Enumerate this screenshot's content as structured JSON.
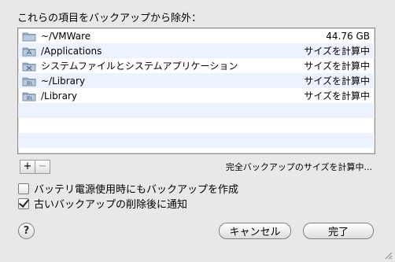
{
  "heading": "これらの項目をバックアップから除外：",
  "exclusions": [
    {
      "icon": "folder-icon",
      "name": "~/VMWare",
      "size": "44.76 GB"
    },
    {
      "icon": "applications-folder-icon",
      "name": "/Applications",
      "size": "サイズを計算中"
    },
    {
      "icon": "system-folder-icon",
      "name": "システムファイルとシステムアプリケーション",
      "size": "サイズを計算中"
    },
    {
      "icon": "library-folder-icon",
      "name": "~/Library",
      "size": "サイズを計算中"
    },
    {
      "icon": "library-folder-icon",
      "name": "/Library",
      "size": "サイズを計算中"
    }
  ],
  "add_label": "+",
  "remove_label": "−",
  "calc_status": "完全バックアップのサイズを計算中...",
  "options": {
    "battery_label": "バッテリ電源使用時にもバックアップを作成",
    "battery_checked": false,
    "notify_label": "古いバックアップの削除後に通知",
    "notify_checked": true
  },
  "help_label": "?",
  "cancel_label": "キャンセル",
  "done_label": "完了"
}
